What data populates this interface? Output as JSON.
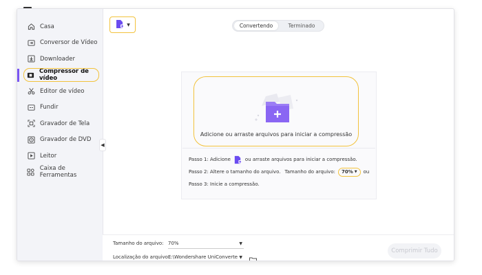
{
  "sidebar": {
    "items": [
      {
        "label": "Casa",
        "icon": "home-icon"
      },
      {
        "label": "Conversor de Vídeo",
        "icon": "video-convert-icon"
      },
      {
        "label": "Downloader",
        "icon": "download-icon"
      },
      {
        "label": "Compressor de vídeo",
        "icon": "compress-icon",
        "active": true
      },
      {
        "label": "Editor de vídeo",
        "icon": "scissors-icon"
      },
      {
        "label": "Fundir",
        "icon": "merge-icon"
      },
      {
        "label": "Gravador de Tela",
        "icon": "screen-record-icon"
      },
      {
        "label": "Gravador de DVD",
        "icon": "dvd-icon"
      },
      {
        "label": "Leitor",
        "icon": "player-icon"
      },
      {
        "label": "Caixa de Ferramentas",
        "icon": "toolbox-icon"
      }
    ]
  },
  "tabs": {
    "converting": "Convertendo",
    "done": "Terminado"
  },
  "drop_zone": {
    "text": "Adicione ou arraste arquivos para iniciar a compressão"
  },
  "steps": {
    "step1_prefix": "Passo 1: Adicione",
    "step1_suffix": "ou arraste arquivos para iniciar a compressão.",
    "step2_prefix": "Passo 2: Altere o tamanho do arquivo.",
    "step2_middle": "Tamanho do arquivo:",
    "step2_value": "70%",
    "step2_suffix": "ou",
    "step3": "Passo 3: Inicie a compressão."
  },
  "bottom": {
    "size_label": "Tamanho do arquivo:",
    "size_value": "70%",
    "location_label": "Localização do arquivo:",
    "location_value": "E:\\Wondershare UniConverte",
    "compress_all": "Comprimir Tudo"
  },
  "colors": {
    "accent": "#7a55f2",
    "highlight": "#f2c23b"
  }
}
